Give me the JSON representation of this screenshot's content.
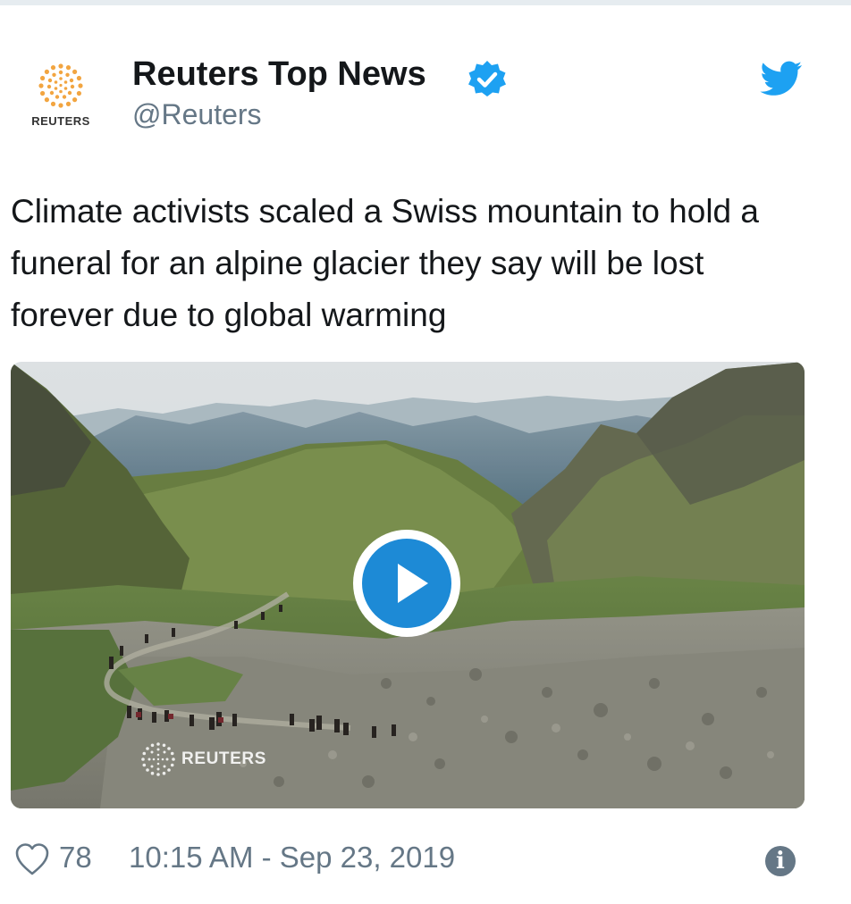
{
  "author": {
    "logo_word": "REUTERS",
    "display_name": "Reuters Top News",
    "handle": "@Reuters",
    "verified": true
  },
  "tweet": {
    "text": "Climate activists scaled a Swiss mountain to hold a funeral for an alpine glacier they say will be lost forever due to global warming"
  },
  "media": {
    "type": "video",
    "watermark": "REUTERS",
    "play_icon": "play-icon"
  },
  "footer": {
    "likes": "78",
    "timestamp": "10:15 AM - Sep 23, 2019"
  },
  "colors": {
    "accent": "#1da1f2",
    "play_button": "#1d8ad6",
    "verified": "#1da1f2",
    "secondary_text": "#657786",
    "logo_orange": "#f2a541"
  }
}
